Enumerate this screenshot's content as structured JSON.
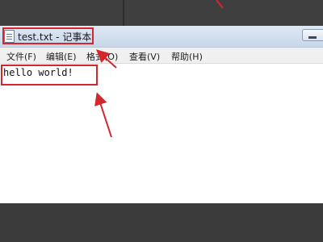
{
  "window": {
    "title": "test.txt - 记事本"
  },
  "menu": {
    "items": [
      "文件(F)",
      "编辑(E)",
      "格式(O)",
      "查看(V)",
      "帮助(H)"
    ]
  },
  "editor": {
    "content": "hello world!"
  },
  "colors": {
    "annotation_red": "#d4262c",
    "titlebar": "#d3dfee",
    "desktop": "#4b4b4b"
  },
  "icons": {
    "app": "notepad-icon",
    "minimize": "minimize-icon"
  }
}
